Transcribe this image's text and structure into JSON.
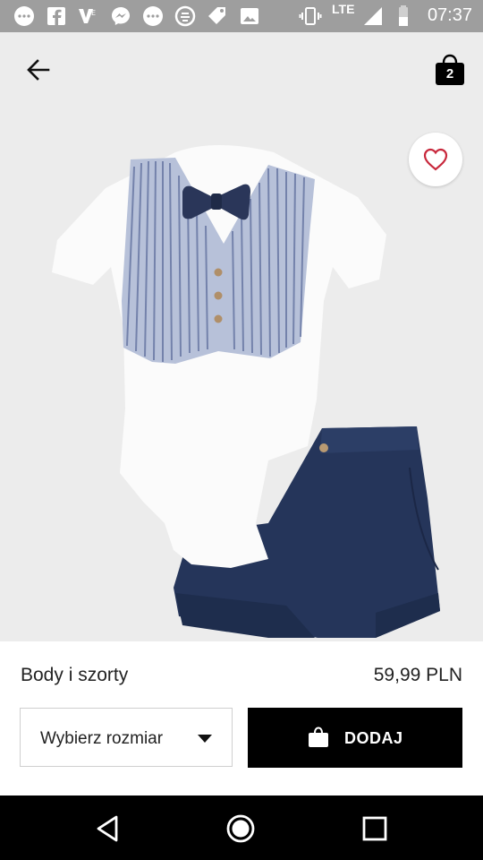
{
  "status_bar": {
    "time": "07:37",
    "network": "LTE",
    "icons": [
      "messenger-icon",
      "facebook-icon",
      "vod-icon",
      "messenger-icon",
      "chat-icon",
      "app-icon",
      "tag-icon",
      "image-icon",
      "vibrate-icon",
      "signal-icon",
      "battery-icon"
    ]
  },
  "header": {
    "back_icon": "arrow-left-icon",
    "bag_count": "2"
  },
  "product": {
    "name": "Body i szorty",
    "price": "59,99 PLN"
  },
  "actions": {
    "size_placeholder": "Wybierz rozmiar",
    "add_label": "DODAJ"
  },
  "colors": {
    "accent": "#000000",
    "favorite": "#c8283c",
    "background": "#ececec"
  }
}
